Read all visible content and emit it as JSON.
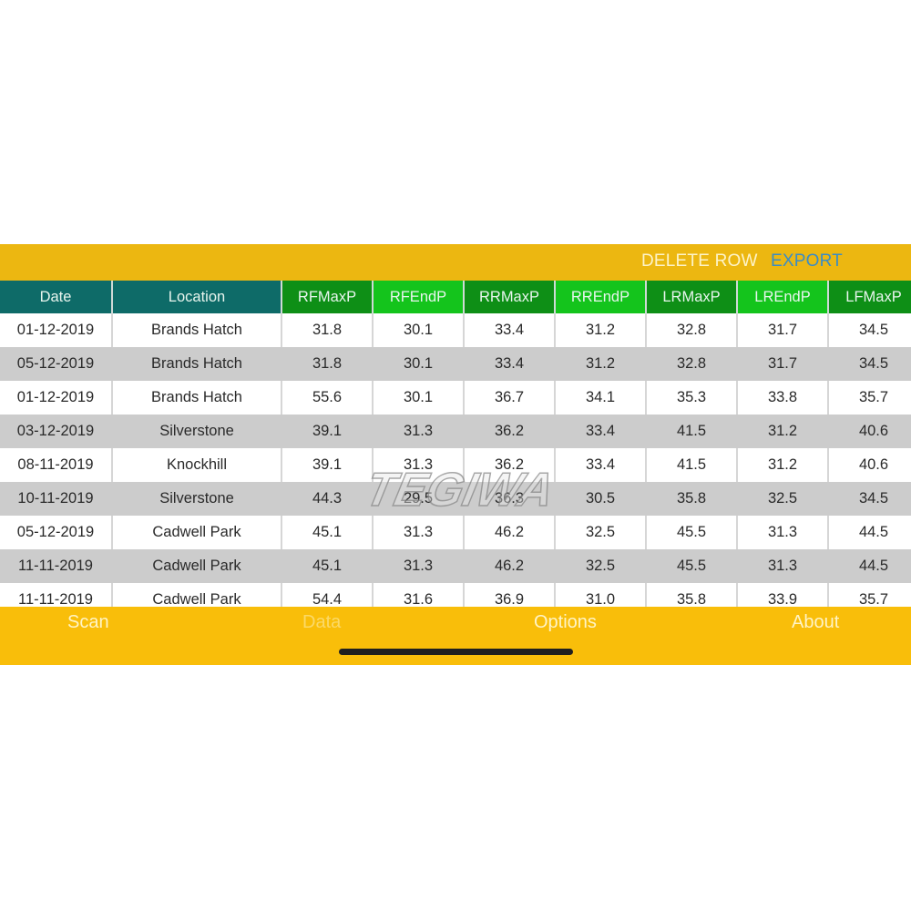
{
  "toolbar": {
    "delete_row_label": "DELETE ROW",
    "export_label": "EXPORT"
  },
  "table": {
    "columns": [
      "Date",
      "Location",
      "RFMaxP",
      "RFEndP",
      "RRMaxP",
      "RREndP",
      "LRMaxP",
      "LREndP",
      "LFMaxP"
    ],
    "rows": [
      [
        "01-12-2019",
        "Brands Hatch",
        "31.8",
        "30.1",
        "33.4",
        "31.2",
        "32.8",
        "31.7",
        "34.5"
      ],
      [
        "05-12-2019",
        "Brands Hatch",
        "31.8",
        "30.1",
        "33.4",
        "31.2",
        "32.8",
        "31.7",
        "34.5"
      ],
      [
        "01-12-2019",
        "Brands Hatch",
        "55.6",
        "30.1",
        "36.7",
        "34.1",
        "35.3",
        "33.8",
        "35.7"
      ],
      [
        "03-12-2019",
        "Silverstone",
        "39.1",
        "31.3",
        "36.2",
        "33.4",
        "41.5",
        "31.2",
        "40.6"
      ],
      [
        "08-11-2019",
        "Knockhill",
        "39.1",
        "31.3",
        "36.2",
        "33.4",
        "41.5",
        "31.2",
        "40.6"
      ],
      [
        "10-11-2019",
        "Silverstone",
        "44.3",
        "29.5",
        "36.3",
        "30.5",
        "35.8",
        "32.5",
        "34.5"
      ],
      [
        "05-12-2019",
        "Cadwell Park",
        "45.1",
        "31.3",
        "46.2",
        "32.5",
        "45.5",
        "31.3",
        "44.5"
      ],
      [
        "11-11-2019",
        "Cadwell Park",
        "45.1",
        "31.3",
        "46.2",
        "32.5",
        "45.5",
        "31.3",
        "44.5"
      ],
      [
        "11-11-2019",
        "Cadwell Park",
        "54.4",
        "31.6",
        "36.9",
        "31.0",
        "35.8",
        "33.9",
        "35.7"
      ]
    ]
  },
  "watermark": {
    "text": "TEGIWA"
  },
  "tabbar": {
    "tabs": [
      {
        "label": "Scan",
        "active": false
      },
      {
        "label": "Data",
        "active": true
      },
      {
        "label": "Options",
        "active": false
      },
      {
        "label": "About",
        "active": false
      }
    ]
  },
  "colors": {
    "toolbar_bg": "#ecb711",
    "tabbar_bg": "#f9be0a",
    "header_teal": "#0e6b68",
    "header_dark_green": "#0e8f16",
    "header_light_green": "#14c41c",
    "export_blue": "#3a8cc6",
    "row_alt_gray": "#cccccc"
  }
}
